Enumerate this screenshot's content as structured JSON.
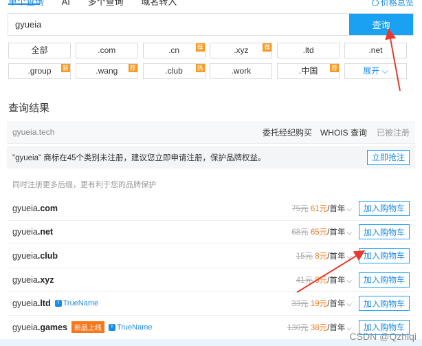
{
  "tabs": {
    "current": "单个查询",
    "ai": "AI",
    "batch": "多个查询",
    "reg": "域名转入"
  },
  "price_link": "价格总览",
  "search": {
    "value": "gyueia",
    "button": "查询"
  },
  "tlds": [
    {
      "label": "全部",
      "badge": ""
    },
    {
      "label": ".com",
      "badge": ""
    },
    {
      "label": ".cn",
      "badge": "荐"
    },
    {
      "label": ".xyz",
      "badge": "荐"
    },
    {
      "label": ".ltd",
      "badge": ""
    },
    {
      "label": ".net",
      "badge": ""
    },
    {
      "label": ".group",
      "badge": "新"
    },
    {
      "label": ".wang",
      "badge": "荐"
    },
    {
      "label": ".club",
      "badge": "热"
    },
    {
      "label": ".work",
      "badge": ""
    },
    {
      "label": ".中国",
      "badge": "荐"
    },
    {
      "label": "展开",
      "badge": ""
    }
  ],
  "results_title": "查询结果",
  "header_row": {
    "domain": "gyueia.tech",
    "broker": "委托经纪购买",
    "whois": "WHOIS 查询",
    "status": "已被注册"
  },
  "warn": {
    "text": "\"gyueia\" 商标在45个类别未注册，建议您立即申请注册，保护品牌权益。",
    "button": "立即抢注"
  },
  "sub_note": "同时注册更多后缀，更有利于您的品牌保护",
  "rows": [
    {
      "prefix": "gyueia",
      "suffix": ".com",
      "old": "75元",
      "now": "61元",
      "unit": "/首年",
      "btn": "加入购物车"
    },
    {
      "prefix": "gyueia",
      "suffix": ".net",
      "old": "68元",
      "now": "65元",
      "unit": "/首年",
      "btn": "加入购物车"
    },
    {
      "prefix": "gyueia",
      "suffix": ".club",
      "old": "15元",
      "now": "8元",
      "unit": "/首年",
      "btn": "加入购物车"
    },
    {
      "prefix": "gyueia",
      "suffix": ".xyz",
      "old": "41元",
      "now": "8元",
      "unit": "/首年",
      "btn": "加入购物车"
    },
    {
      "prefix": "gyueia",
      "suffix": ".ltd",
      "old": "33元",
      "now": "19元",
      "unit": "/首年",
      "btn": "加入购物车",
      "tn": "TrueName"
    },
    {
      "prefix": "gyueia",
      "suffix": ".games",
      "old": "130元",
      "now": "38元",
      "unit": "/首年",
      "btn": "加入购物车",
      "badge": "新品上线",
      "tn": "TrueName"
    }
  ],
  "watermark": "CSDN @Qzhiqi",
  "colors": {
    "accent": "#1aa1f2",
    "orange": "#f59a23",
    "arrow": "#e8392c"
  }
}
